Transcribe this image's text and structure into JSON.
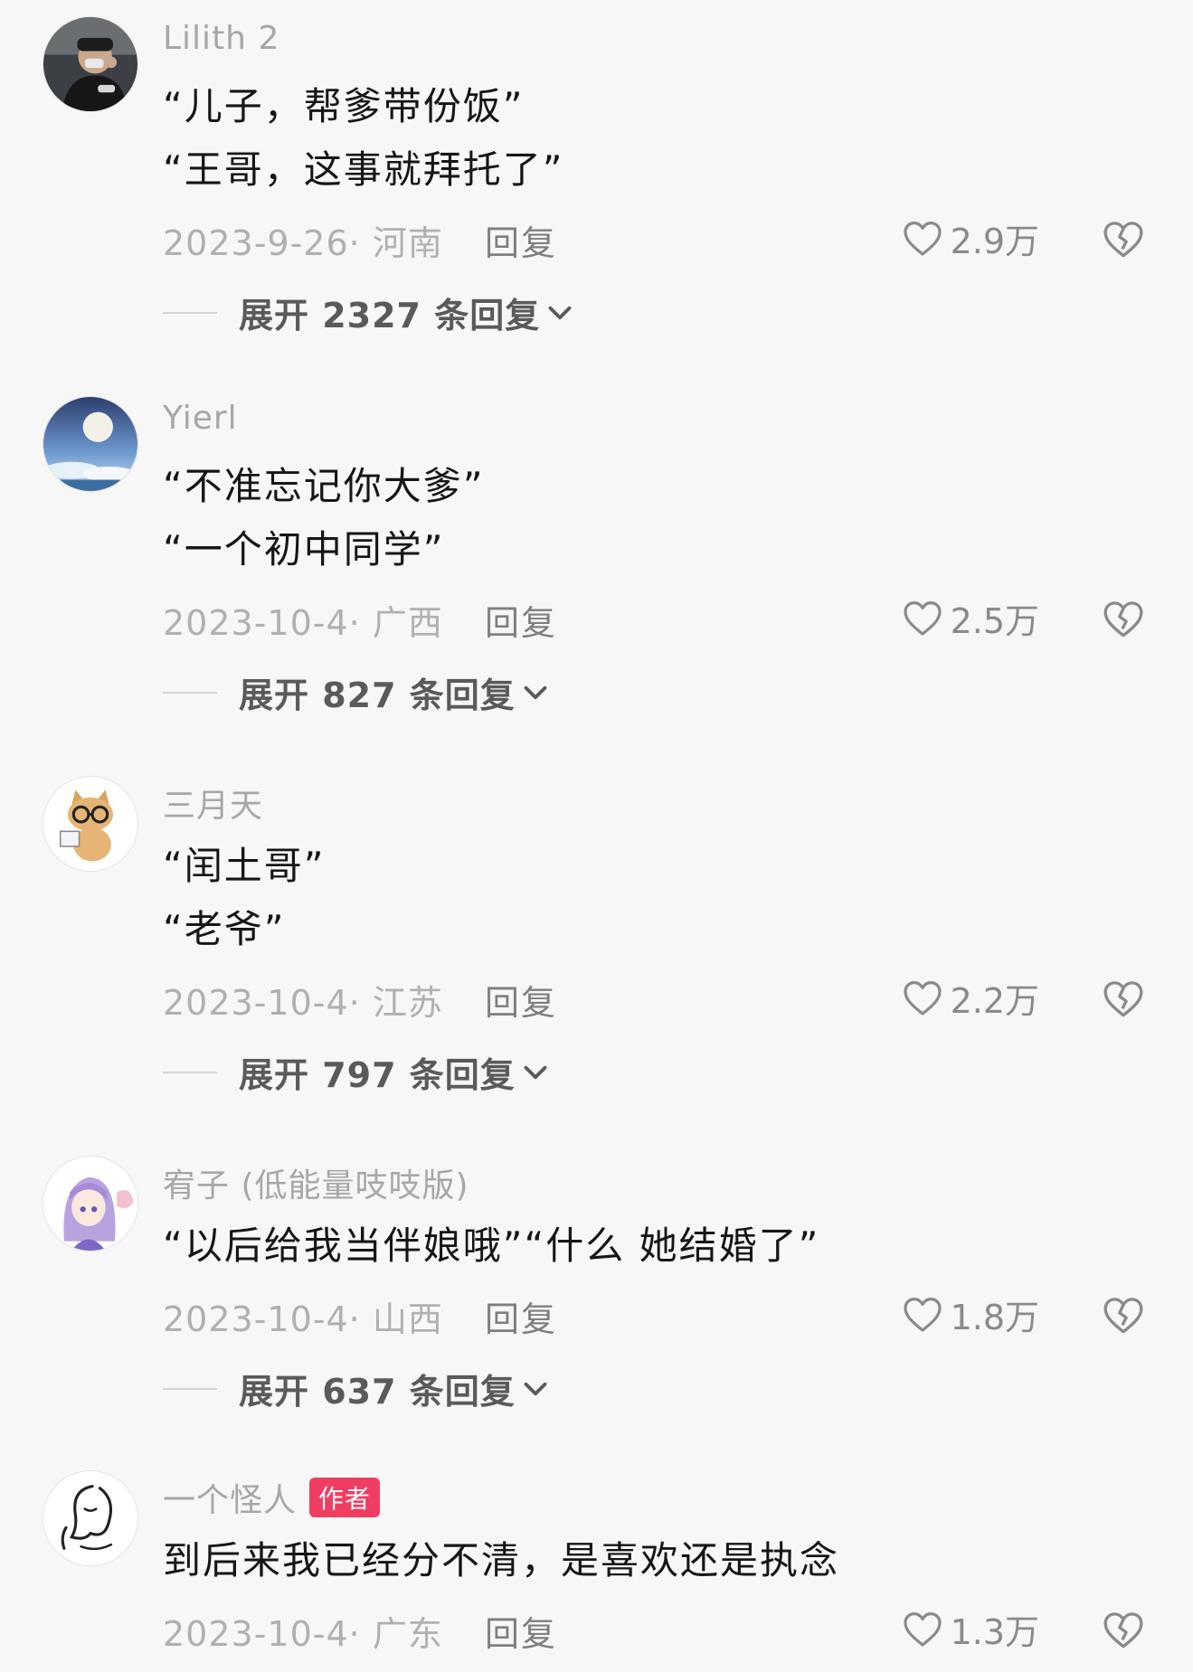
{
  "comments": [
    {
      "username": "Lilith 2",
      "lines": [
        "“儿子，帮爹带份饭”",
        "“王哥，这事就拜托了”"
      ],
      "date_location": "2023-9-26· 河南",
      "reply_label": "回复",
      "likes": "2.9万",
      "expand_label": "展开 2327 条回复",
      "avatar_icon": "person-photo-avatar"
    },
    {
      "username": "Yierl",
      "lines": [
        "“不准忘记你大爹”",
        "“一个初中同学”"
      ],
      "date_location": "2023-10-4· 广西",
      "reply_label": "回复",
      "likes": "2.5万",
      "expand_label": "展开 827 条回复",
      "avatar_icon": "moon-sky-avatar"
    },
    {
      "username": "三月天",
      "lines": [
        "“闰土哥”",
        "“老爷”"
      ],
      "date_location": "2023-10-4· 江苏",
      "reply_label": "回复",
      "likes": "2.2万",
      "expand_label": "展开 797 条回复",
      "avatar_icon": "cat-glasses-avatar"
    },
    {
      "username": "宥子 (低能量吱吱版)",
      "lines": [
        "“以后给我当伴娘哦”“什么 她结婚了”"
      ],
      "date_location": "2023-10-4· 山西",
      "reply_label": "回复",
      "likes": "1.8万",
      "expand_label": "展开 637 条回复",
      "avatar_icon": "anime-girl-avatar"
    },
    {
      "username": "一个怪人",
      "author_badge": "作者",
      "lines": [
        "到后来我已经分不清，是喜欢还是执念"
      ],
      "date_location": "2023-10-4· 广东",
      "reply_label": "回复",
      "likes": "1.3万",
      "avatar_icon": "line-art-face-avatar"
    }
  ],
  "icons": {
    "like": "heart-outline-icon",
    "dislike": "broken-heart-icon",
    "expand": "chevron-down-icon"
  },
  "colors": {
    "background": "#f7f7f7",
    "author_badge": "#f03e63",
    "username": "#a7a7a7",
    "meta": "#b0b0b0"
  }
}
